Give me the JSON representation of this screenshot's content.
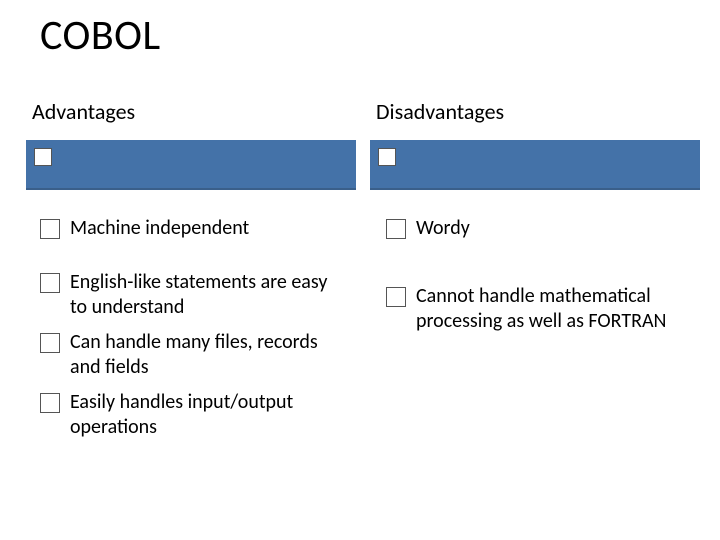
{
  "title": "COBOL",
  "columns": {
    "left_header": "Advantages",
    "right_header": "Disadvantages"
  },
  "advantages": [
    "Machine independent",
    "English-like statements are easy to understand",
    "Can handle many files, records and fields",
    "Easily handles input/output operations"
  ],
  "disadvantages": [
    "Wordy",
    "Cannot handle mathematical processing as well as FORTRAN"
  ],
  "colors": {
    "bar": "#4472a8"
  }
}
